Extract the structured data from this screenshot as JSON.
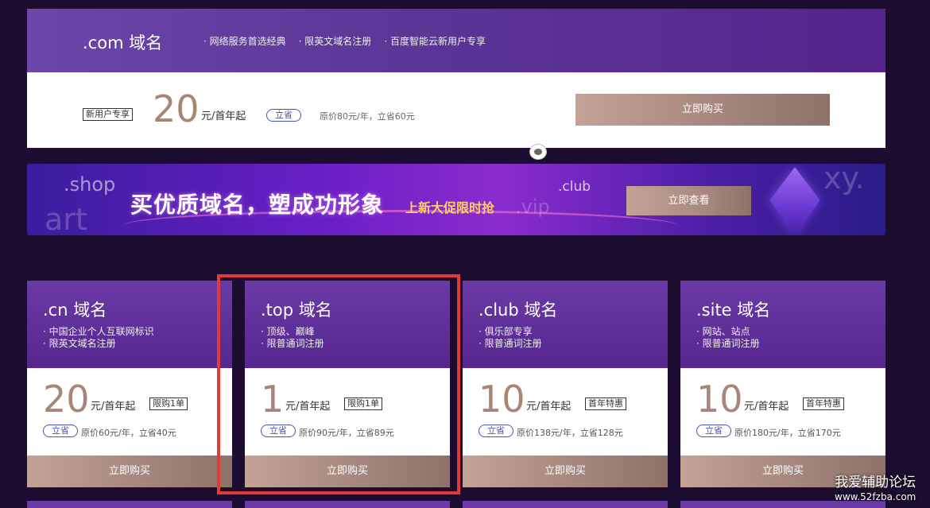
{
  "com_card": {
    "title": ".com 域名",
    "features": [
      "网络服务首选经典",
      "限英文域名注册",
      "百度智能云新用户专享"
    ],
    "tag": "新用户专享",
    "price": "20",
    "unit": "元/首年起",
    "save_label": "立省",
    "original": "原价80元/年，立省60元",
    "buy_label": "立即购买"
  },
  "banner": {
    "watermarks": {
      "shop": ".shop",
      "art": "art",
      "vip": ".vip",
      "club": ".club",
      "xy": "xy."
    },
    "title": "买优质域名，塑成功形象",
    "subtitle": "上新大促限时抢",
    "button_label": "立即查看"
  },
  "cards": [
    {
      "title": ".cn 域名",
      "features": [
        "中国企业个人互联网标识",
        "限英文域名注册"
      ],
      "price": "20",
      "unit": "元/首年起",
      "limit": "限购1单",
      "save_label": "立省",
      "original": "原价60元/年，立省40元",
      "buy_label": "立即购买"
    },
    {
      "title": ".top 域名",
      "features": [
        "顶级、巅峰",
        "限普通词注册"
      ],
      "price": "1",
      "unit": "元/首年起",
      "limit": "限购1单",
      "save_label": "立省",
      "original": "原价90元/年，立省89元",
      "buy_label": "立即购买"
    },
    {
      "title": ".club 域名",
      "features": [
        "俱乐部专享",
        "限普通词注册"
      ],
      "price": "10",
      "unit": "元/首年起",
      "limit": "首年特惠",
      "save_label": "立省",
      "original": "原价138元/年，立省128元",
      "buy_label": "立即购买"
    },
    {
      "title": ".site 域名",
      "features": [
        "网站、站点",
        "限普通词注册"
      ],
      "price": "10",
      "unit": "元/首年起",
      "limit": "首年特惠",
      "save_label": "立省",
      "original": "原价180元/年，立省170元",
      "buy_label": "立即购买"
    }
  ],
  "watermark": {
    "line1": "我爱辅助论坛",
    "line2": "www.52fzba.com"
  },
  "colors": {
    "price": "#a98577",
    "highlight": "#e53935",
    "save_pill": "#4a56a8"
  }
}
